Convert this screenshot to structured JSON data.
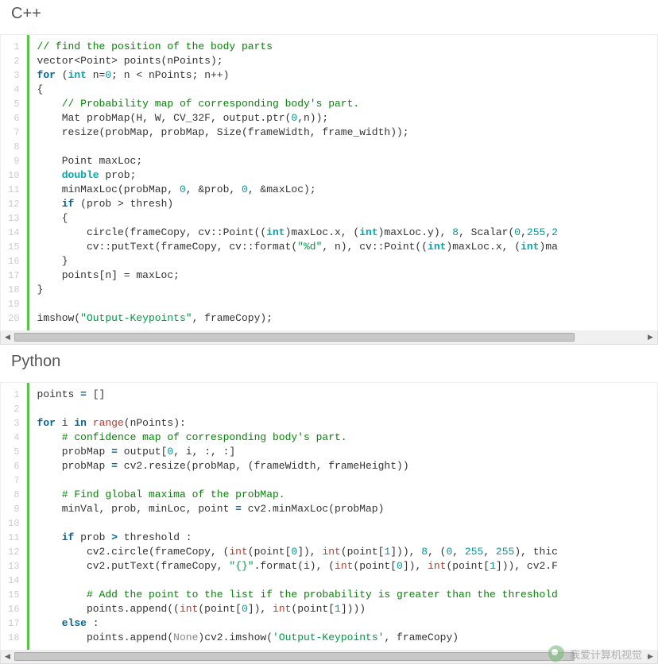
{
  "block1": {
    "title": "C++",
    "lines": [
      [
        {
          "cls": "c",
          "t": "// find the position of the body parts"
        }
      ],
      [
        {
          "t": "vector<Point> points(nPoints);"
        }
      ],
      [
        {
          "cls": "k",
          "t": "for"
        },
        {
          "t": " ("
        },
        {
          "cls": "t",
          "t": "int"
        },
        {
          "t": " n="
        },
        {
          "cls": "n",
          "t": "0"
        },
        {
          "t": "; n < nPoints; n++)"
        }
      ],
      [
        {
          "t": "{"
        }
      ],
      [
        {
          "t": "    "
        },
        {
          "cls": "c",
          "t": "// Probability map of corresponding body's part."
        }
      ],
      [
        {
          "t": "    Mat probMap(H, W, CV_32F, output.ptr("
        },
        {
          "cls": "n",
          "t": "0"
        },
        {
          "t": ",n));"
        }
      ],
      [
        {
          "t": "    resize(probMap, probMap, Size(frameWidth, frame_width));"
        }
      ],
      [
        {
          "t": ""
        }
      ],
      [
        {
          "t": "    Point maxLoc;"
        }
      ],
      [
        {
          "t": "    "
        },
        {
          "cls": "t",
          "t": "double"
        },
        {
          "t": " prob;"
        }
      ],
      [
        {
          "t": "    minMaxLoc(probMap, "
        },
        {
          "cls": "n",
          "t": "0"
        },
        {
          "t": ", &prob, "
        },
        {
          "cls": "n",
          "t": "0"
        },
        {
          "t": ", &maxLoc);"
        }
      ],
      [
        {
          "t": "    "
        },
        {
          "cls": "k",
          "t": "if"
        },
        {
          "t": " (prob > thresh)"
        }
      ],
      [
        {
          "t": "    {"
        }
      ],
      [
        {
          "t": "        circle(frameCopy, cv::Point(("
        },
        {
          "cls": "t",
          "t": "int"
        },
        {
          "t": ")maxLoc.x, ("
        },
        {
          "cls": "t",
          "t": "int"
        },
        {
          "t": ")maxLoc.y), "
        },
        {
          "cls": "n",
          "t": "8"
        },
        {
          "t": ", Scalar("
        },
        {
          "cls": "n",
          "t": "0"
        },
        {
          "t": ","
        },
        {
          "cls": "n",
          "t": "255"
        },
        {
          "t": ","
        },
        {
          "cls": "n",
          "t": "2"
        }
      ],
      [
        {
          "t": "        cv::putText(frameCopy, cv::format("
        },
        {
          "cls": "s",
          "t": "\"%d\""
        },
        {
          "t": ", n), cv::Point(("
        },
        {
          "cls": "t",
          "t": "int"
        },
        {
          "t": ")maxLoc.x, ("
        },
        {
          "cls": "t",
          "t": "int"
        },
        {
          "t": ")ma"
        }
      ],
      [
        {
          "t": "    }"
        }
      ],
      [
        {
          "t": "    points[n] = maxLoc;"
        }
      ],
      [
        {
          "t": "}"
        }
      ],
      [
        {
          "t": ""
        }
      ],
      [
        {
          "t": "imshow("
        },
        {
          "cls": "s",
          "t": "\"Output-Keypoints\""
        },
        {
          "t": ", frameCopy);"
        }
      ]
    ],
    "start_no": 1,
    "scroll": {
      "thumb_left": 0,
      "thumb_width": 89
    }
  },
  "block2": {
    "title": "Python",
    "lines": [
      [
        {
          "t": "points "
        },
        {
          "cls": "k",
          "t": "="
        },
        {
          "t": " []"
        }
      ],
      [
        {
          "t": ""
        }
      ],
      [
        {
          "cls": "k",
          "t": "for"
        },
        {
          "t": " i "
        },
        {
          "cls": "k",
          "t": "in"
        },
        {
          "t": " "
        },
        {
          "cls": "fn",
          "t": "range"
        },
        {
          "t": "(nPoints):"
        }
      ],
      [
        {
          "t": "    "
        },
        {
          "cls": "c",
          "t": "# confidence map of corresponding body's part."
        }
      ],
      [
        {
          "t": "    probMap "
        },
        {
          "cls": "k",
          "t": "="
        },
        {
          "t": " output["
        },
        {
          "cls": "n",
          "t": "0"
        },
        {
          "t": ", i, :, :]"
        }
      ],
      [
        {
          "t": "    probMap "
        },
        {
          "cls": "k",
          "t": "="
        },
        {
          "t": " cv2.resize(probMap, (frameWidth, frameHeight))"
        }
      ],
      [
        {
          "t": ""
        }
      ],
      [
        {
          "t": "    "
        },
        {
          "cls": "c",
          "t": "# Find global maxima of the probMap."
        }
      ],
      [
        {
          "t": "    minVal, prob, minLoc, point "
        },
        {
          "cls": "k",
          "t": "="
        },
        {
          "t": " cv2.minMaxLoc(probMap)"
        }
      ],
      [
        {
          "t": ""
        }
      ],
      [
        {
          "t": "    "
        },
        {
          "cls": "k",
          "t": "if"
        },
        {
          "t": " prob "
        },
        {
          "cls": "k",
          "t": ">"
        },
        {
          "t": " threshold :"
        }
      ],
      [
        {
          "t": "        cv2.circle(frameCopy, ("
        },
        {
          "cls": "fn",
          "t": "int"
        },
        {
          "t": "(point["
        },
        {
          "cls": "n",
          "t": "0"
        },
        {
          "t": "]), "
        },
        {
          "cls": "fn",
          "t": "int"
        },
        {
          "t": "(point["
        },
        {
          "cls": "n",
          "t": "1"
        },
        {
          "t": "])), "
        },
        {
          "cls": "n",
          "t": "8"
        },
        {
          "t": ", ("
        },
        {
          "cls": "n",
          "t": "0"
        },
        {
          "t": ", "
        },
        {
          "cls": "n",
          "t": "255"
        },
        {
          "t": ", "
        },
        {
          "cls": "n",
          "t": "255"
        },
        {
          "t": "), thic"
        }
      ],
      [
        {
          "t": "        cv2.putText(frameCopy, "
        },
        {
          "cls": "s",
          "t": "\"{}\""
        },
        {
          "t": ".format(i), ("
        },
        {
          "cls": "fn",
          "t": "int"
        },
        {
          "t": "(point["
        },
        {
          "cls": "n",
          "t": "0"
        },
        {
          "t": "]), "
        },
        {
          "cls": "fn",
          "t": "int"
        },
        {
          "t": "(point["
        },
        {
          "cls": "n",
          "t": "1"
        },
        {
          "t": "])), cv2.F"
        }
      ],
      [
        {
          "t": ""
        }
      ],
      [
        {
          "t": "        "
        },
        {
          "cls": "c",
          "t": "# Add the point to the list if the probability is greater than the threshold"
        }
      ],
      [
        {
          "t": "        points.append(("
        },
        {
          "cls": "fn",
          "t": "int"
        },
        {
          "t": "(point["
        },
        {
          "cls": "n",
          "t": "0"
        },
        {
          "t": "]), "
        },
        {
          "cls": "fn",
          "t": "int"
        },
        {
          "t": "(point["
        },
        {
          "cls": "n",
          "t": "1"
        },
        {
          "t": "])))"
        }
      ],
      [
        {
          "t": "    "
        },
        {
          "cls": "k",
          "t": "else"
        },
        {
          "t": " :"
        }
      ],
      [
        {
          "t": "        points.append("
        },
        {
          "cls": "g",
          "t": "None"
        },
        {
          "t": ")cv2.imshow("
        },
        {
          "cls": "s",
          "t": "'Output-Keypoints'"
        },
        {
          "t": ", frameCopy)"
        }
      ]
    ],
    "start_no": 1,
    "scroll": {
      "thumb_left": 0,
      "thumb_width": 89
    }
  },
  "watermark": "我爱计算机视觉"
}
